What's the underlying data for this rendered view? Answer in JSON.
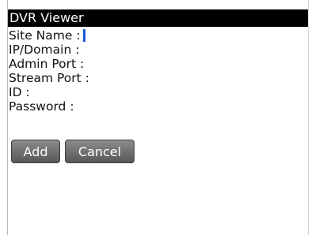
{
  "window": {
    "title": "DVR Viewer"
  },
  "form": {
    "fields": [
      {
        "label": "Site Name :",
        "value": ""
      },
      {
        "label": "IP/Domain :",
        "value": ""
      },
      {
        "label": "Admin Port :",
        "value": ""
      },
      {
        "label": "Stream Port :",
        "value": ""
      },
      {
        "label": "ID :",
        "value": ""
      },
      {
        "label": "Password :",
        "value": ""
      }
    ],
    "focused_field": "Site Name :"
  },
  "buttons": {
    "add_label": "Add",
    "cancel_label": "Cancel"
  },
  "colors": {
    "title_bar": "#000000",
    "caret": "#1a5bd8",
    "button_bg": "#6e6e6e"
  }
}
